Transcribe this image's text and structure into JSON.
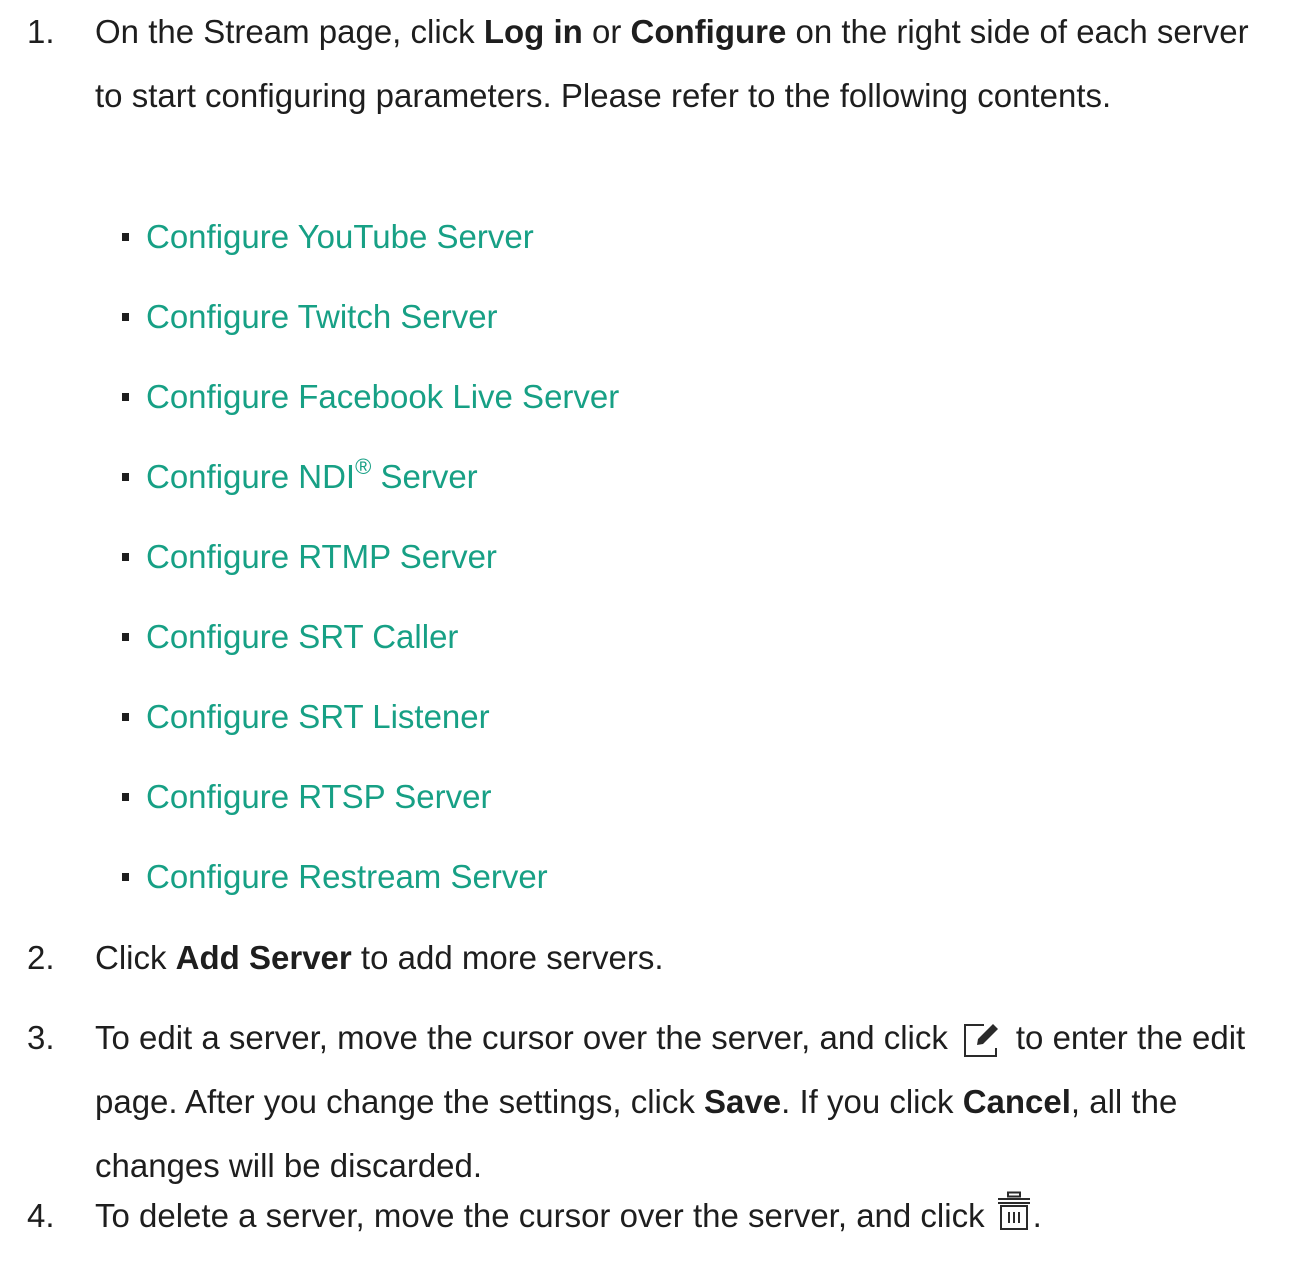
{
  "steps": [
    {
      "number": "1.",
      "text_a": "On the Stream page, click ",
      "bold_a": "Log in",
      "text_b": " or ",
      "bold_b": "Configure",
      "text_c": " on the right side of each server to start configuring parameters. Please refer to the following contents."
    },
    {
      "number": "2.",
      "text_a": "Click ",
      "bold_a": "Add Server",
      "text_b": " to add more servers."
    },
    {
      "number": "3.",
      "text_a": "To edit a server, move the cursor over the server, and click",
      "icon": "edit-icon",
      "text_b": "to enter the edit page. After you change the settings, click ",
      "bold_a": "Save",
      "text_c": ". If you click ",
      "bold_b": "Cancel",
      "text_d": ", all the changes will be discarded."
    },
    {
      "number": "4.",
      "text_a": "To delete a server, move the cursor over the server, and click",
      "icon": "trash-icon",
      "text_b": "."
    }
  ],
  "links": [
    {
      "label": "Configure YouTube Server"
    },
    {
      "label": "Configure Twitch Server"
    },
    {
      "label": "Configure Facebook Live Server"
    },
    {
      "label": "Configure NDI",
      "sup": "®",
      "label_after": " Server"
    },
    {
      "label": "Configure RTMP Server"
    },
    {
      "label": "Configure SRT Caller"
    },
    {
      "label": "Configure SRT Listener"
    },
    {
      "label": "Configure RTSP Server"
    },
    {
      "label": "Configure Restream Server"
    }
  ],
  "colors": {
    "link": "#17a085",
    "text": "#1e1e1e"
  }
}
